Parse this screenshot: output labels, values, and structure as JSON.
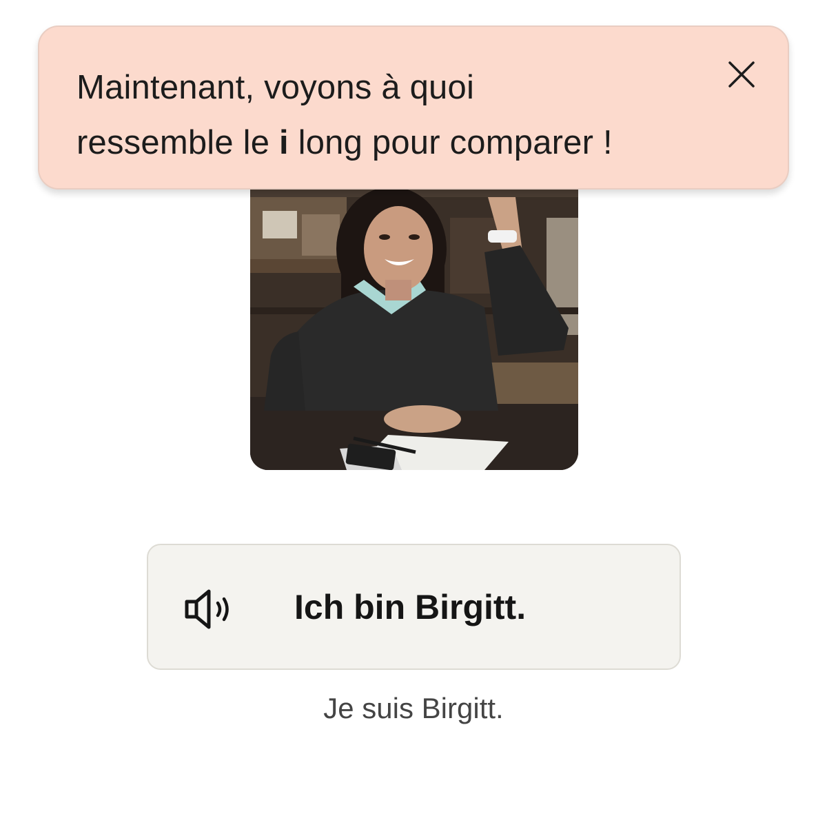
{
  "toast": {
    "line1": "Maintenant, voyons à quoi",
    "line2_before": "ressemble le ",
    "line2_bold": "i",
    "line2_after": " long pour comparer !",
    "close_icon": "close-icon",
    "background_color": "#fcdacd"
  },
  "illustration": {
    "image_icon": "woman-raising-hand-photo"
  },
  "phrase": {
    "text": "Ich bin Birgitt.",
    "audio_icon": "speaker-icon",
    "background_color": "#f4f3ef"
  },
  "translation": {
    "text": "Je suis Birgitt."
  }
}
